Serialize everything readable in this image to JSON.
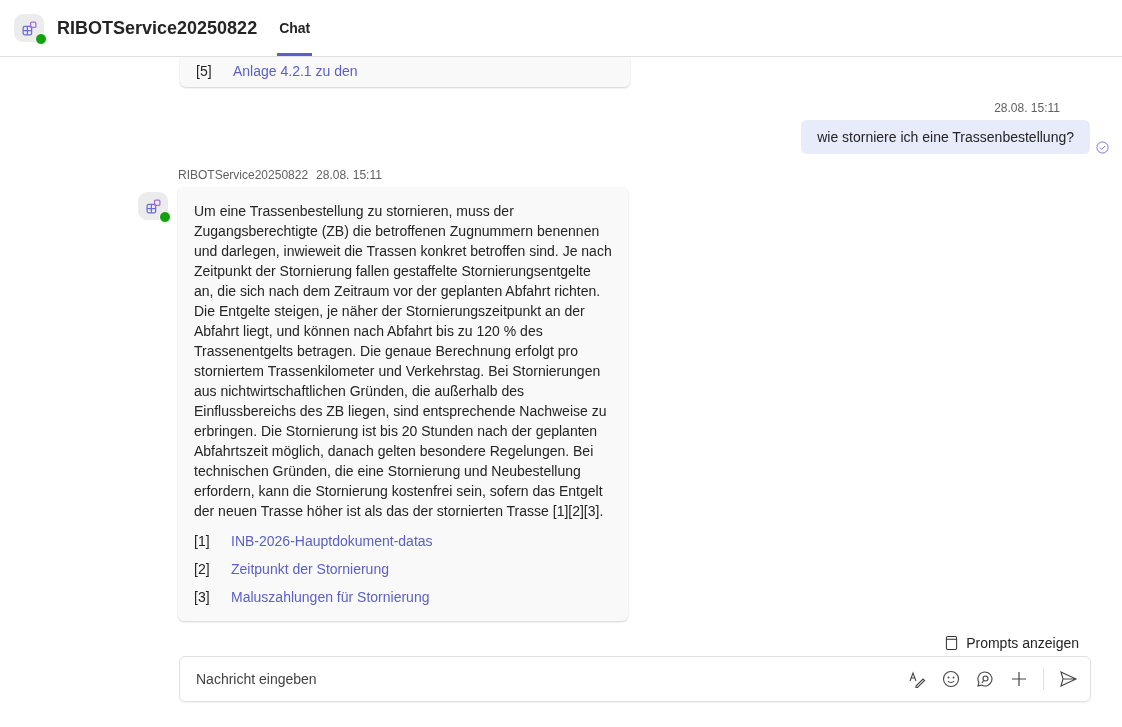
{
  "header": {
    "title": "RIBOTService20250822",
    "tabs": [
      {
        "label": "Chat",
        "selected": true
      }
    ]
  },
  "previous_message": {
    "citations": [
      {
        "index": "[5]",
        "title": "Anlage 4.2.1 zu den"
      }
    ]
  },
  "user_message": {
    "time": "28.08. 15:11",
    "text": "wie storniere ich eine Trassenbestellung?"
  },
  "bot_message": {
    "sender": "RIBOTService20250822",
    "time": "28.08. 15:11",
    "text": "Um eine Trassenbestellung zu stornieren, muss der Zugangsberechtigte (ZB) die betroffenen Zugnummern benennen und darlegen, inwieweit die Trassen konkret betroffen sind. Je nach Zeitpunkt der Stornierung fallen gestaffelte Stornierungsentgelte an, die sich nach dem Zeitraum vor der geplanten Abfahrt richten. Die Entgelte steigen, je näher der Stornierungszeitpunkt an der Abfahrt liegt, und können nach Abfahrt bis zu 120 % des Trassenentgelts betragen. Die genaue Berechnung erfolgt pro storniertem Trassenkilometer und Verkehrstag. Bei Stornierungen aus nichtwirtschaftlichen Gründen, die außerhalb des Einflussbereichs des ZB liegen, sind entsprechende Nachweise zu erbringen. Die Stornierung ist bis 20 Stunden nach der geplanten Abfahrtszeit möglich, danach gelten besondere Regelungen. Bei technischen Gründen, die eine Stornierung und Neubestellung erfordern, kann die Stornierung kostenfrei sein, sofern das Entgelt der neuen Trasse höher ist als das der stornierten Trasse [1][2][3].",
    "citations": [
      {
        "index": "[1]",
        "title": "INB-2026-Hauptdokument-datas"
      },
      {
        "index": "[2]",
        "title": "Zeitpunkt der Stornierung"
      },
      {
        "index": "[3]",
        "title": "Maluszahlungen für Stornierung"
      }
    ]
  },
  "prompts_button": "Prompts anzeigen",
  "composer": {
    "placeholder": "Nachricht eingeben"
  }
}
